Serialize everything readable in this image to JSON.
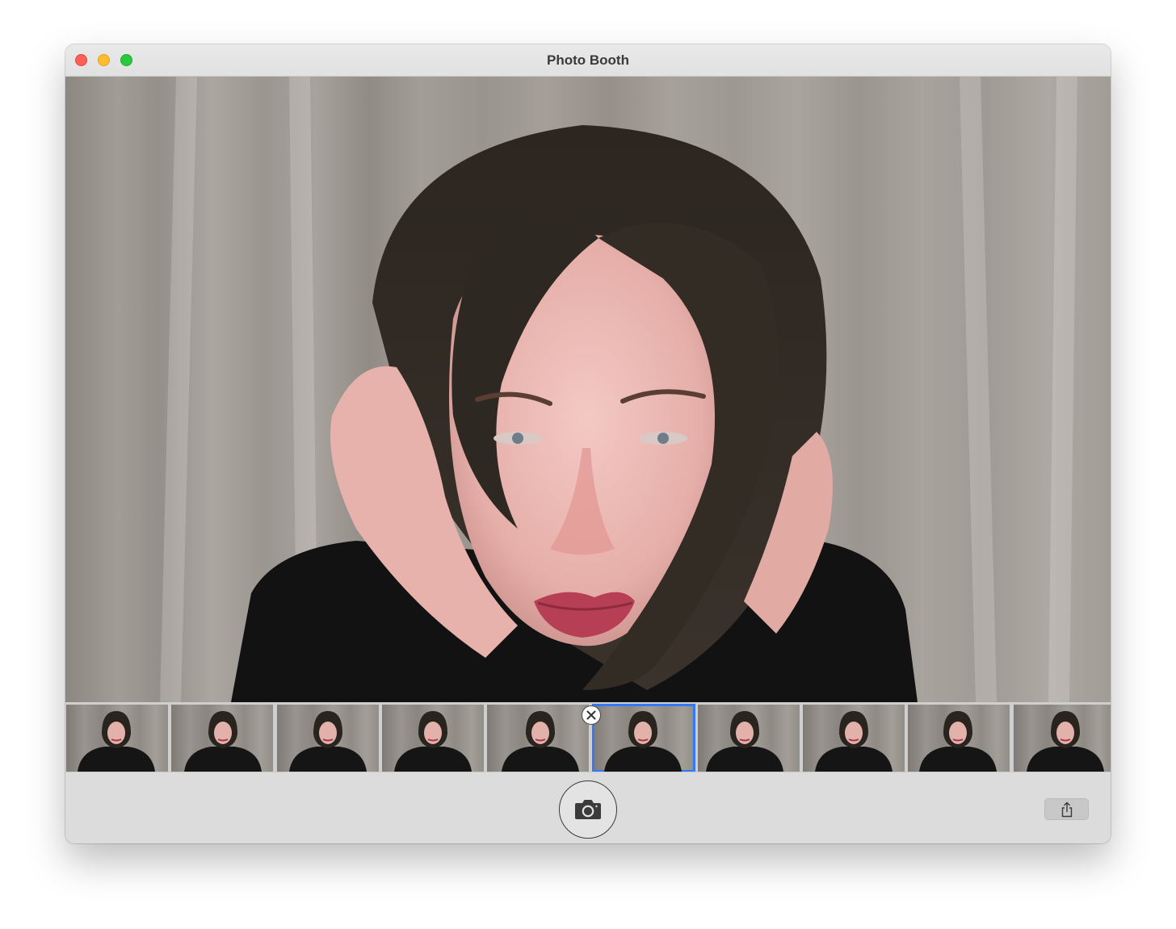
{
  "window": {
    "title": "Photo Booth"
  },
  "colors": {
    "close": "#ff5f57",
    "minimize": "#febc2e",
    "maximize": "#28c840",
    "selection": "#3478f6"
  },
  "preview": {
    "icon": "live-camera-preview"
  },
  "strip": {
    "count": 10,
    "selected_index": 5
  },
  "toolbar": {
    "shutter_icon": "camera-icon",
    "share_icon": "share-icon",
    "delete_icon": "close-icon"
  }
}
